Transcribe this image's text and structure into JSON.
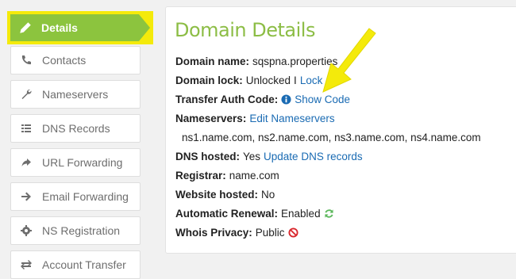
{
  "sidebar": {
    "items": [
      {
        "label": "Details",
        "icon": "pencil-icon"
      },
      {
        "label": "Contacts",
        "icon": "phone-icon"
      },
      {
        "label": "Nameservers",
        "icon": "wrench-icon"
      },
      {
        "label": "DNS Records",
        "icon": "list-icon"
      },
      {
        "label": "URL Forwarding",
        "icon": "share-arrow-icon"
      },
      {
        "label": "Email Forwarding",
        "icon": "arrow-right-icon"
      },
      {
        "label": "NS Registration",
        "icon": "gear-icon"
      },
      {
        "label": "Account Transfer",
        "icon": "transfer-icon"
      }
    ],
    "active_index": 0
  },
  "main": {
    "title": "Domain Details",
    "domain_name": {
      "label": "Domain name:",
      "value": "sqspna.properties"
    },
    "domain_lock": {
      "label": "Domain lock:",
      "value": "Unlocked",
      "separator": "I",
      "link": "Lock"
    },
    "transfer_auth": {
      "label": "Transfer Auth Code:",
      "link": "Show Code",
      "icon": "info-icon"
    },
    "nameservers": {
      "label": "Nameservers:",
      "link": "Edit Nameservers",
      "list": "ns1.name.com, ns2.name.com, ns3.name.com, ns4.name.com"
    },
    "dns_hosted": {
      "label": "DNS hosted:",
      "value": "Yes",
      "link": "Update DNS records"
    },
    "registrar": {
      "label": "Registrar:",
      "value": "name.com"
    },
    "website_hosted": {
      "label": "Website hosted:",
      "value": "No"
    },
    "auto_renewal": {
      "label": "Automatic Renewal:",
      "value": "Enabled",
      "icon": "refresh-icon"
    },
    "whois_privacy": {
      "label": "Whois Privacy:",
      "value": "Public",
      "icon": "prohibited-icon"
    }
  },
  "colors": {
    "accent_green": "#8cc43e",
    "title_green": "#8cbd45",
    "highlight_yellow": "#f4ea0b",
    "link_blue": "#1a6bb3",
    "prohibited_red": "#d9262c"
  }
}
